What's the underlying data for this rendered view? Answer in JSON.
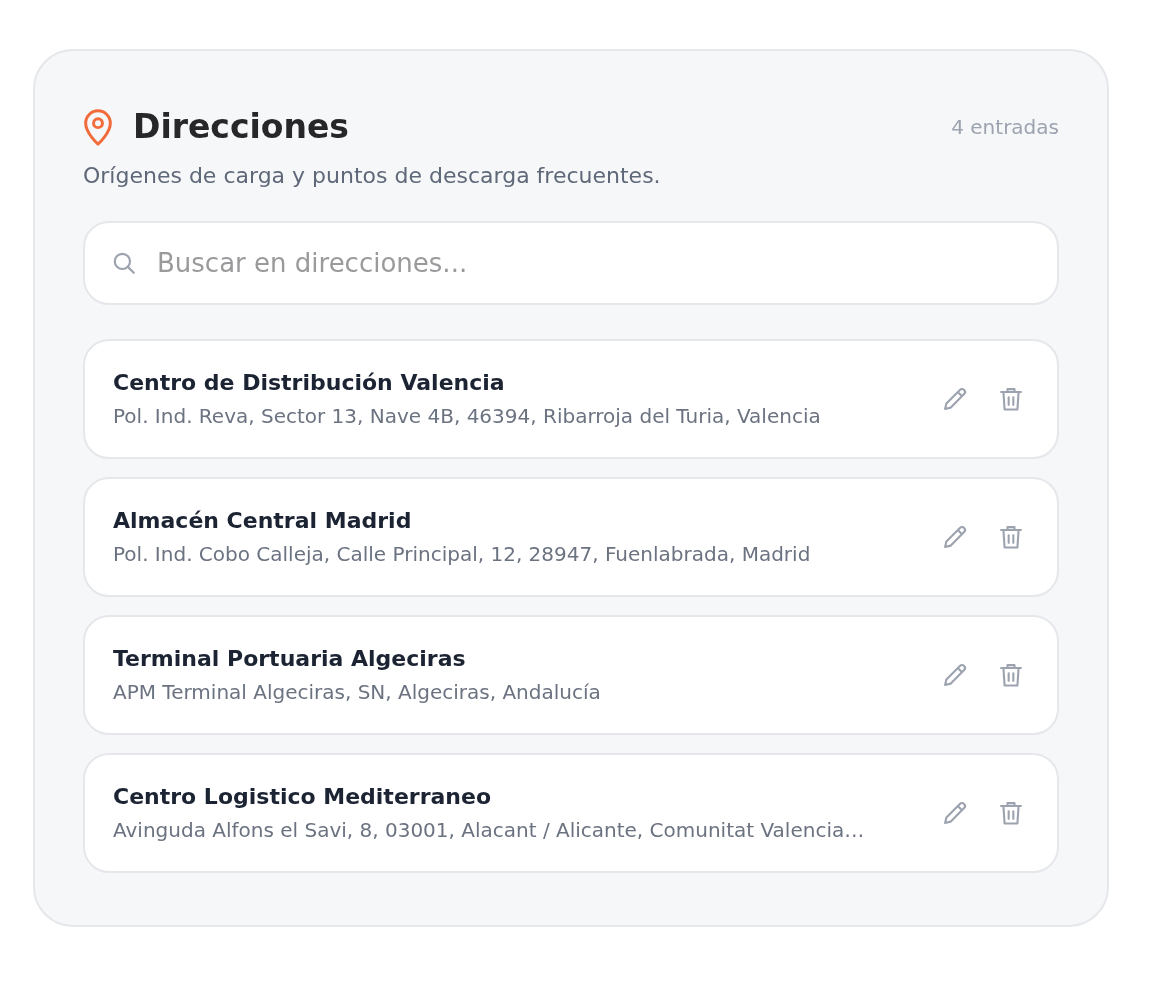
{
  "panel": {
    "title": "Direcciones",
    "count": "4 entradas",
    "subtitle": "Orígenes de carga y puntos de descarga frecuentes."
  },
  "search": {
    "placeholder": "Buscar en direcciones..."
  },
  "addresses": [
    {
      "name": "Centro de Distribución Valencia",
      "address": "Pol. Ind. Reva, Sector 13, Nave 4B, 46394, Ribarroja del Turia, Valencia"
    },
    {
      "name": "Almacén Central Madrid",
      "address": "Pol. Ind. Cobo Calleja, Calle Principal, 12, 28947, Fuenlabrada, Madrid"
    },
    {
      "name": "Terminal Portuaria Algeciras",
      "address": "APM Terminal Algeciras, SN, Algeciras, Andalucía"
    },
    {
      "name": "Centro Logistico Mediterraneo",
      "address": "Avinguda Alfons el Savi, 8, 03001, Alacant / Alicante, Comunitat Valencia…"
    }
  ]
}
